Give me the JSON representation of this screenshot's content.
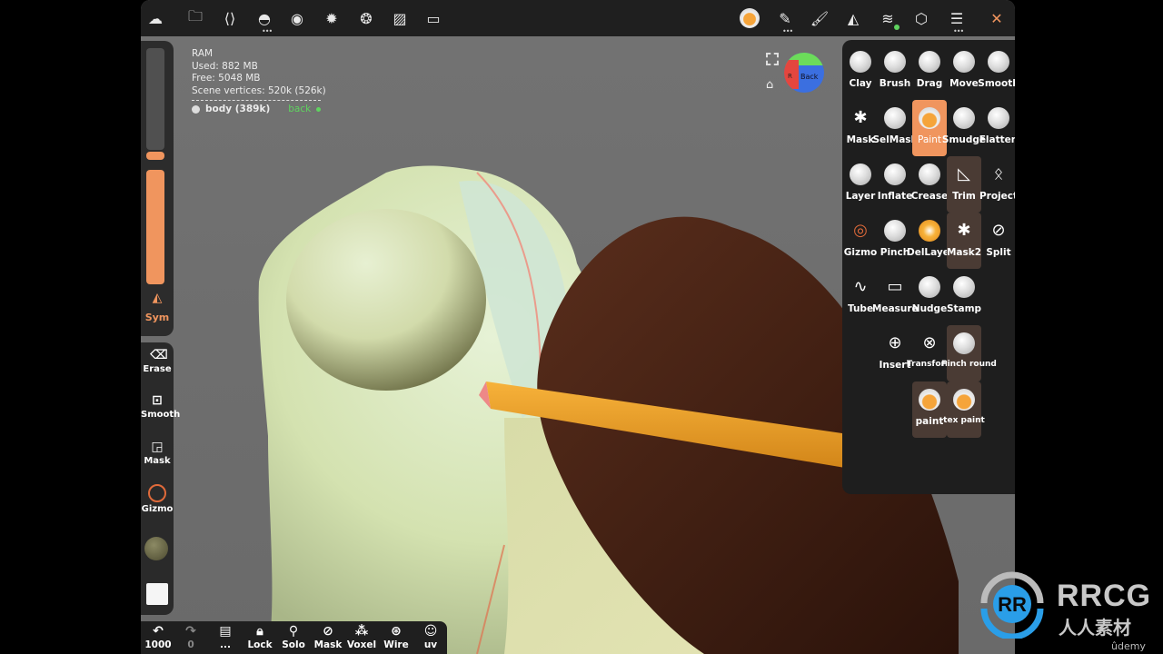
{
  "top_toolbar": {
    "left_icons": [
      {
        "name": "cloud-icon"
      },
      {
        "name": "folder-icon"
      },
      {
        "name": "share-icon"
      },
      {
        "name": "scene-icon",
        "has_menu": true
      },
      {
        "name": "matcap-sphere-icon"
      },
      {
        "name": "light-icon"
      },
      {
        "name": "environment-icon"
      },
      {
        "name": "image-icon"
      },
      {
        "name": "video-icon"
      }
    ],
    "right_icons": [
      {
        "name": "material-sphere-icon"
      },
      {
        "name": "stroke-icon",
        "has_menu": true
      },
      {
        "name": "painting-icon"
      },
      {
        "name": "symmetry-icon"
      },
      {
        "name": "layers-icon",
        "status_dot": "green"
      },
      {
        "name": "settings-icon"
      },
      {
        "name": "tool-settings-icon",
        "has_menu": true
      },
      {
        "name": "tools-icon"
      }
    ]
  },
  "info_overlay": {
    "ram_label": "RAM",
    "used": "Used: 882 MB",
    "free": "Free: 5048 MB",
    "scene_vertices": "Scene vertices: 520k (526k)",
    "object_name": "body (389k)",
    "layer_name": "back"
  },
  "left_sliders": {
    "radius_fraction": 0.08,
    "intensity_fraction": 1.0,
    "sym_label": "Sym"
  },
  "left_tools": [
    {
      "label": "Erase",
      "icon": "eraser-icon"
    },
    {
      "label": "Smooth",
      "icon": "smooth-icon"
    },
    {
      "label": "Mask",
      "icon": "mask-icon"
    },
    {
      "label": "Gizmo",
      "icon": "gizmo-icon"
    }
  ],
  "view_cube": {
    "front_label": "Back",
    "side_label": "R"
  },
  "bottom_bar": [
    {
      "label": "1000",
      "icon": "undo-icon"
    },
    {
      "label": "0",
      "icon": "redo-icon"
    },
    {
      "label": "...",
      "icon": "document-icon"
    },
    {
      "label": "Lock",
      "icon": "lock-icon"
    },
    {
      "label": "Solo",
      "icon": "search-icon"
    },
    {
      "label": "Mask",
      "icon": "mask-hide-icon"
    },
    {
      "label": "Voxel",
      "icon": "voxel-icon"
    },
    {
      "label": "Wire",
      "icon": "wire-icon"
    },
    {
      "label": "uv",
      "icon": "uv-icon"
    }
  ],
  "right_tools": [
    {
      "label": "Clay"
    },
    {
      "label": "Brush"
    },
    {
      "label": "Drag"
    },
    {
      "label": "Move"
    },
    {
      "label": "Smooth"
    },
    {
      "label": "Mask"
    },
    {
      "label": "SelMask"
    },
    {
      "label": "Paint",
      "selected": true
    },
    {
      "label": "Smudge"
    },
    {
      "label": "Flatten"
    },
    {
      "label": "Layer"
    },
    {
      "label": "Inflate"
    },
    {
      "label": "Crease"
    },
    {
      "label": "Trim"
    },
    {
      "label": "Project"
    },
    {
      "label": "Gizmo"
    },
    {
      "label": "Pinch"
    },
    {
      "label": "DelLayer"
    },
    {
      "label": "Mask2"
    },
    {
      "label": "Split"
    },
    {
      "label": "Tube"
    },
    {
      "label": "Measure"
    },
    {
      "label": "Nudge"
    },
    {
      "label": "Stamp"
    },
    {
      "label": "Insert"
    },
    {
      "label": "Transform"
    },
    {
      "label": "Pinch round"
    },
    {
      "label": "paint"
    },
    {
      "label": "tex paint"
    }
  ],
  "watermark": {
    "brand": "RRCG",
    "subtitle": "人人素材",
    "source": "ûdemy"
  },
  "colors": {
    "accent": "#f0955e",
    "panel": "#1f1f1f",
    "viewport": "#6e6e6e",
    "layer_active": "#5fd35f",
    "model": "#d8e6b8"
  }
}
